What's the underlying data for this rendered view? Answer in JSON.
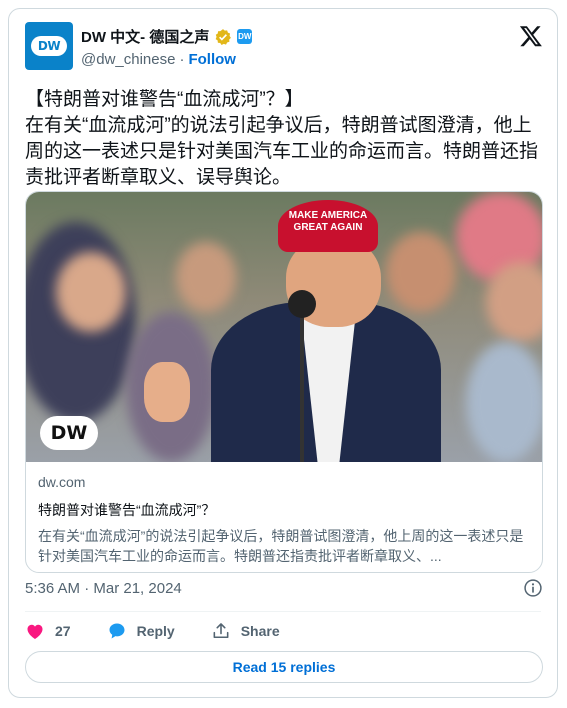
{
  "author": {
    "display_name": "DW 中文- 德国之声",
    "handle": "@dw_chinese",
    "separator": "·",
    "follow_label": "Follow",
    "avatar_text": "DW",
    "affiliate_badge_text": "DW"
  },
  "tweet": {
    "text": "【特朗普对谁警告“血流成河”？】\n在有关“血流成河”的说法引起争议后，特朗普试图澄清，他上周的这一表述只是针对美国汽车工业的命运而言。特朗普还指责批评者断章取义、误导舆论。",
    "timestamp": "5:36 AM · Mar 21, 2024"
  },
  "link_card": {
    "domain": "dw.com",
    "title": "特朗普对谁警告“血流成河”？",
    "description": "在有关“血流成河”的说法引起争议后，特朗普试图澄清，他上周的这一表述只是针对美国汽车工业的命运而言。特朗普还指责批评者断章取义、...",
    "image_watermark": "DW",
    "cap_text": "MAKE AMERICA GREAT AGAIN"
  },
  "actions": {
    "likes_count": "27",
    "reply_label": "Reply",
    "share_label": "Share"
  },
  "read_replies_label": "Read 15 replies",
  "icons": {
    "verified": "verified-badge-icon",
    "x_logo": "x-logo-icon",
    "info": "info-icon",
    "heart": "heart-icon",
    "reply": "reply-bubble-icon",
    "share": "share-icon"
  },
  "colors": {
    "brand_blue": "#0a82c9",
    "link_blue": "#006fd6",
    "heart_pink": "#f91880",
    "reply_blue": "#1d9bf0",
    "verified_gold": "#e2b719",
    "text_primary": "#0f1419",
    "text_secondary": "#536471"
  }
}
